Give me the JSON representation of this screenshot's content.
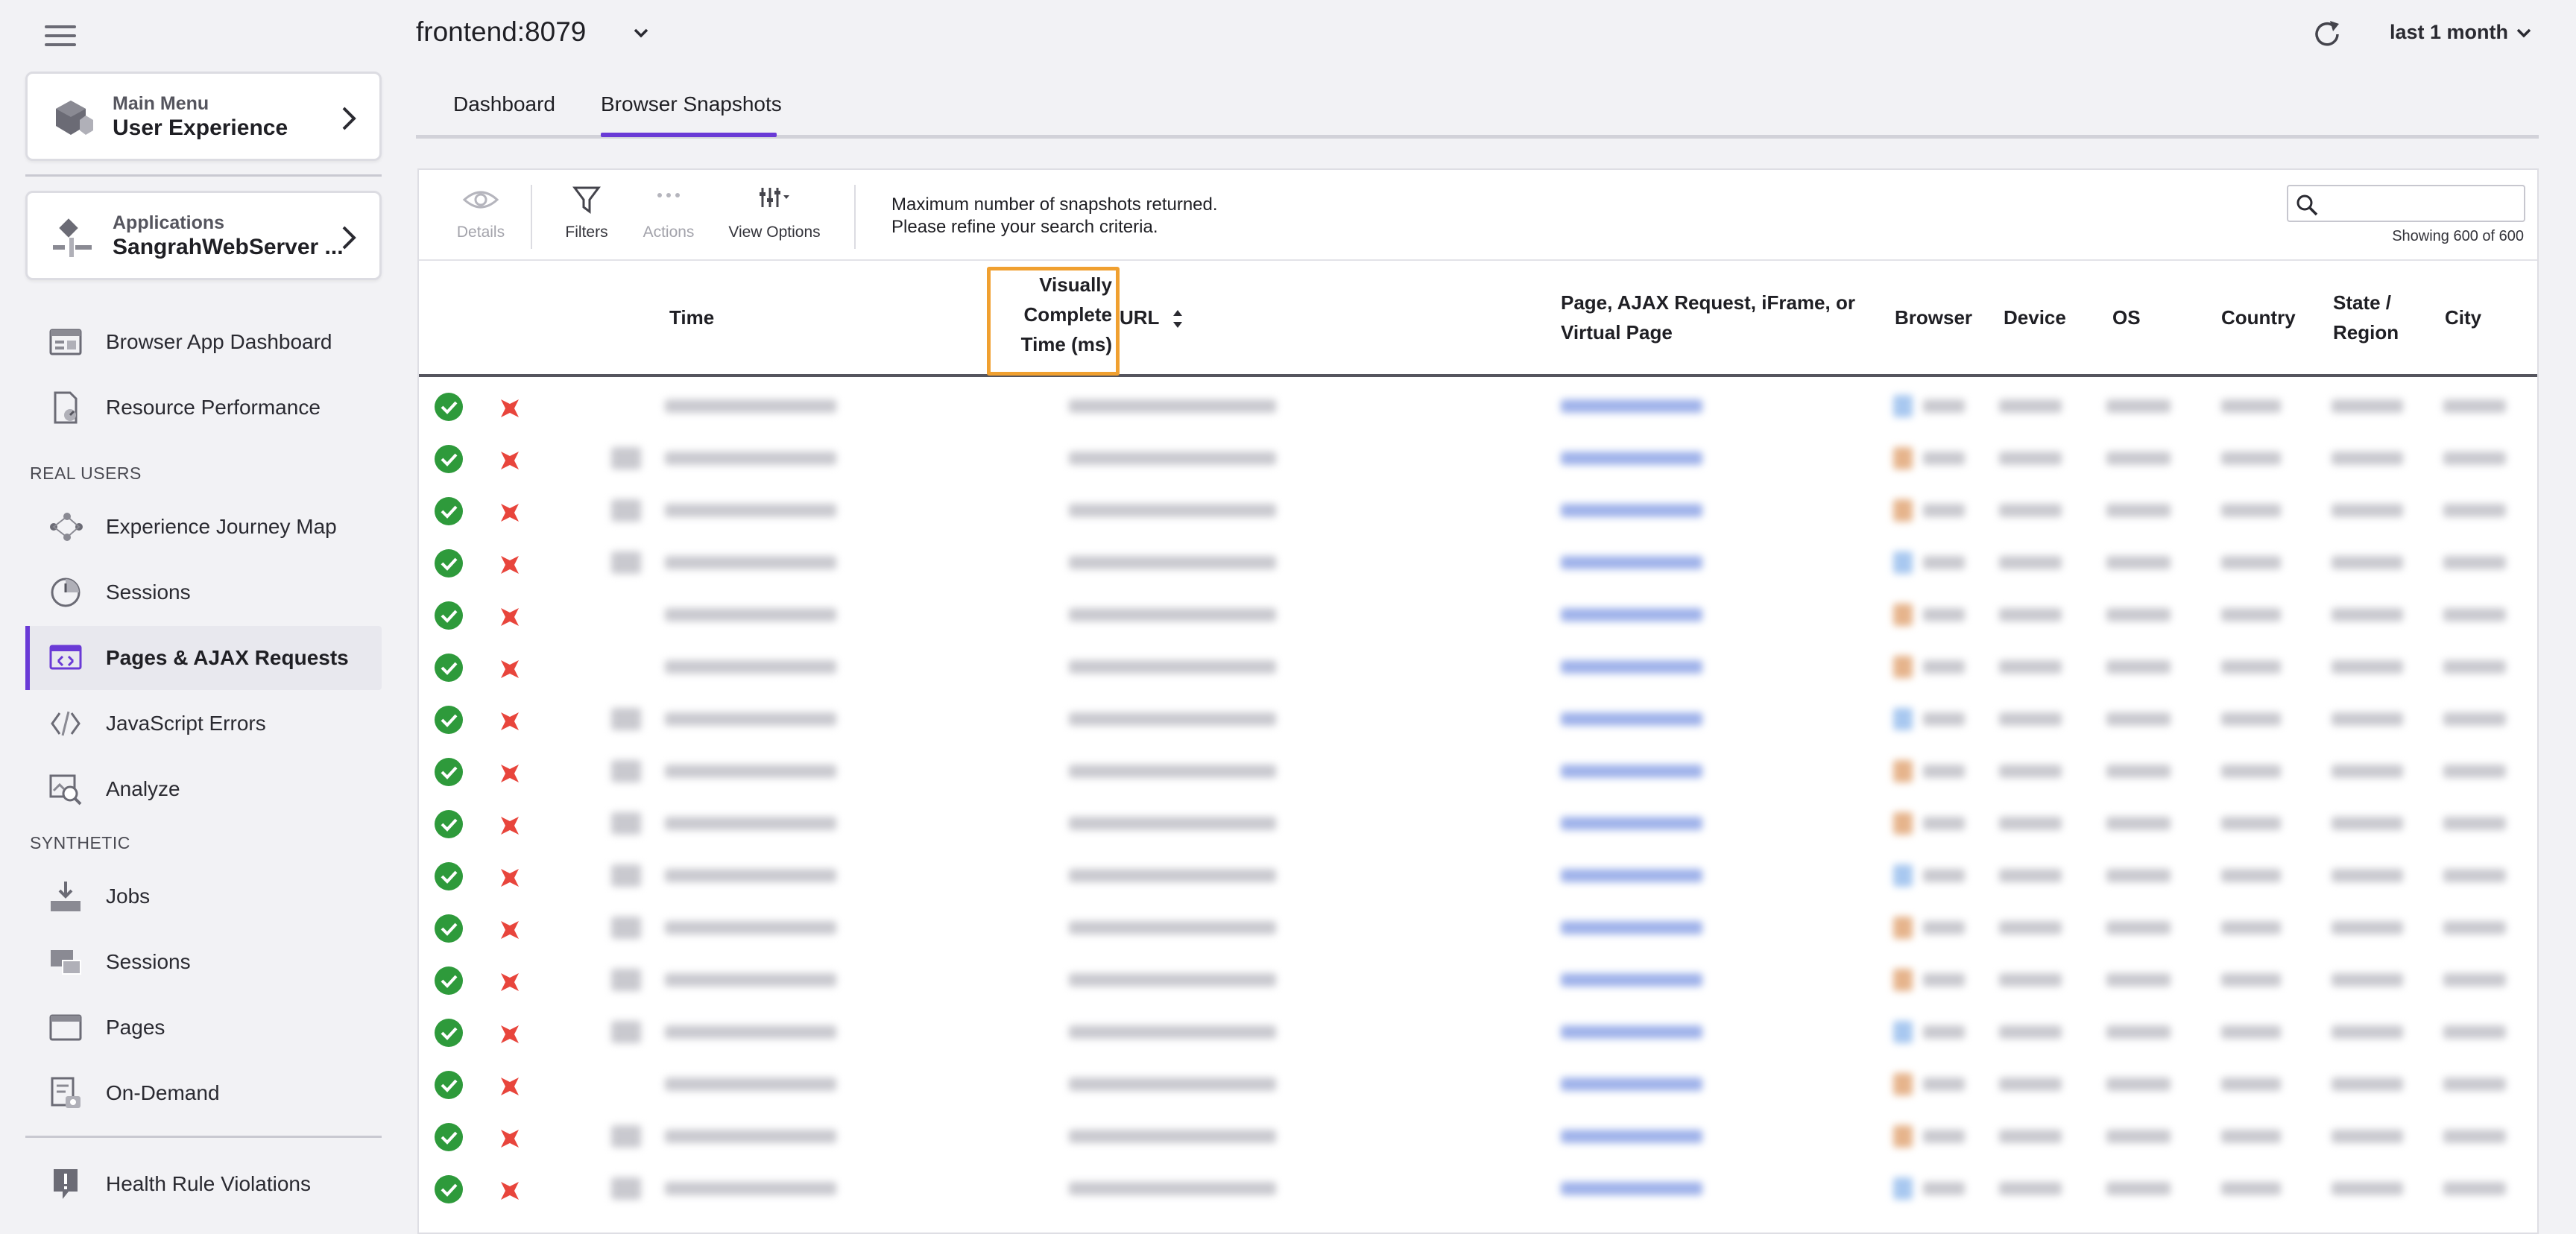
{
  "sidebar": {
    "main_menu": {
      "sub": "Main Menu",
      "title": "User Experience"
    },
    "applications": {
      "sub": "Applications",
      "title": "SangrahWebServer ..."
    },
    "items_top": [
      {
        "label": "Browser App Dashboard",
        "icon": "dashboard-icon"
      },
      {
        "label": "Resource Performance",
        "icon": "resource-performance-icon"
      }
    ],
    "section_real_users": "REAL USERS",
    "items_real_users": [
      {
        "label": "Experience Journey Map",
        "icon": "journey-map-icon"
      },
      {
        "label": "Sessions",
        "icon": "sessions-icon"
      },
      {
        "label": "Pages & AJAX Requests",
        "icon": "pages-ajax-icon",
        "active": true
      },
      {
        "label": "JavaScript Errors",
        "icon": "javascript-errors-icon"
      },
      {
        "label": "Analyze",
        "icon": "analyze-icon"
      }
    ],
    "section_synthetic": "SYNTHETIC",
    "items_synthetic": [
      {
        "label": "Jobs",
        "icon": "jobs-icon"
      },
      {
        "label": "Sessions",
        "icon": "synthetic-sessions-icon"
      },
      {
        "label": "Pages",
        "icon": "pages-icon"
      },
      {
        "label": "On-Demand",
        "icon": "on-demand-icon"
      }
    ],
    "items_bottom": [
      {
        "label": "Health Rule Violations",
        "icon": "health-rule-icon"
      }
    ]
  },
  "header": {
    "app_title": "frontend:8079",
    "time_range": "last 1 month"
  },
  "tabs": [
    {
      "label": "Dashboard"
    },
    {
      "label": "Browser Snapshots",
      "active": true
    }
  ],
  "toolbar": {
    "details": "Details",
    "filters": "Filters",
    "actions": "Actions",
    "view_options": "View Options",
    "notice_line1": "Maximum number of snapshots returned.",
    "notice_line2": "Please refine your search criteria.",
    "search_placeholder": "",
    "showing": "Showing 600 of 600"
  },
  "table": {
    "columns": {
      "time": "Time",
      "vct_line1": "Visually",
      "vct_line2": "Complete",
      "vct_line3": "Time (ms)",
      "url": "URL",
      "page_line1": "Page, AJAX Request, iFrame, or",
      "page_line2": "Virtual Page",
      "browser": "Browser",
      "device": "Device",
      "os": "OS",
      "country": "Country",
      "state_line1": "State /",
      "state_line2": "Region",
      "city": "City"
    },
    "rows": [
      {
        "ok": true,
        "error": true,
        "thumb": false
      },
      {
        "ok": true,
        "error": true,
        "thumb": true
      },
      {
        "ok": true,
        "error": true,
        "thumb": true
      },
      {
        "ok": true,
        "error": true,
        "thumb": true
      },
      {
        "ok": true,
        "error": true,
        "thumb": false
      },
      {
        "ok": true,
        "error": true,
        "thumb": false
      },
      {
        "ok": true,
        "error": true,
        "thumb": true
      },
      {
        "ok": true,
        "error": true,
        "thumb": true
      },
      {
        "ok": true,
        "error": true,
        "thumb": true
      },
      {
        "ok": true,
        "error": true,
        "thumb": true
      },
      {
        "ok": true,
        "error": true,
        "thumb": true
      },
      {
        "ok": true,
        "error": true,
        "thumb": true
      },
      {
        "ok": true,
        "error": true,
        "thumb": true
      },
      {
        "ok": true,
        "error": true,
        "thumb": false
      },
      {
        "ok": true,
        "error": true,
        "thumb": true
      },
      {
        "ok": true,
        "error": true,
        "thumb": true
      }
    ]
  },
  "colors": {
    "accent": "#6a3ad6",
    "highlight": "#f0a030",
    "ok": "#2e9a3b",
    "error": "#e8453c",
    "link_blur": "#9fb2ea"
  }
}
